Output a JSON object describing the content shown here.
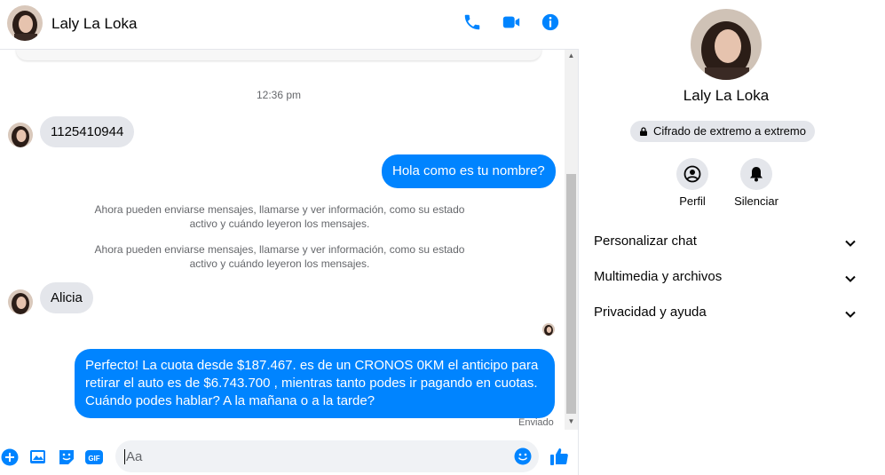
{
  "contact": {
    "name": "Laly La Loka"
  },
  "messages": {
    "timestamp": "12:36 pm",
    "m1": "1125410944",
    "m2": "Hola como es tu nombre?",
    "sys1_line1": "Ahora pueden enviarse mensajes, llamarse y ver información, como su estado",
    "sys1_line2": "activo y cuándo leyeron los mensajes.",
    "sys2_line1": "Ahora pueden enviarse mensajes, llamarse y ver información, como su estado",
    "sys2_line2": "activo y cuándo leyeron los mensajes.",
    "m3": "Alicia",
    "m4_line1": "Perfecto! La cuota desde $187.467. es de un CRONOS 0KM el anticipo para",
    "m4_line2": "retirar el auto es de $6.743.700 , mientras tanto podes ir pagando en cuotas.",
    "m4_line3": "Cuándo podes hablar? A la mañana o a la tarde?",
    "status": "Enviado"
  },
  "composer": {
    "placeholder": "Aa"
  },
  "sidebar": {
    "name": "Laly La Loka",
    "encryption": "Cifrado de extremo a extremo",
    "profile_label": "Perfil",
    "mute_label": "Silenciar",
    "rows": [
      "Personalizar chat",
      "Multimedia y archivos",
      "Privacidad y ayuda"
    ]
  },
  "colors": {
    "accent": "#0084ff",
    "bubble_in": "#e4e6eb"
  },
  "icons": [
    "phone-icon",
    "video-icon",
    "info-icon",
    "plus-icon",
    "photo-icon",
    "sticker-icon",
    "gif-icon",
    "emoji-icon",
    "like-icon",
    "lock-icon",
    "profile-icon",
    "bell-icon",
    "chevron-down-icon"
  ]
}
